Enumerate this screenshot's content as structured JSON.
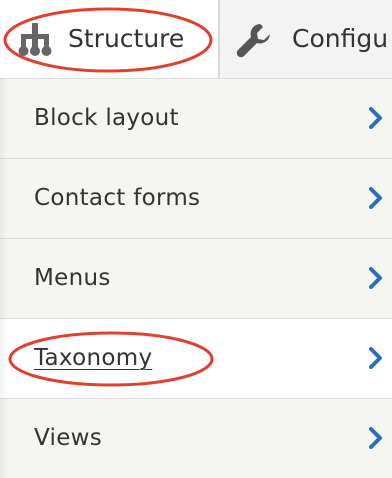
{
  "toolbar": {
    "structure_label": "Structure",
    "configuration_label": "Configu"
  },
  "menu": {
    "items": [
      {
        "label": "Block layout"
      },
      {
        "label": "Contact forms"
      },
      {
        "label": "Menus"
      },
      {
        "label": "Taxonomy"
      },
      {
        "label": "Views"
      }
    ]
  },
  "colors": {
    "highlight": "#e0412d",
    "chevron": "#2c6fb6",
    "text": "#333333",
    "menu_bg": "#f5f5f2"
  },
  "icons": {
    "structure": "sitemap-icon",
    "configuration": "wrench-icon",
    "chevron": "chevron-right-icon"
  }
}
